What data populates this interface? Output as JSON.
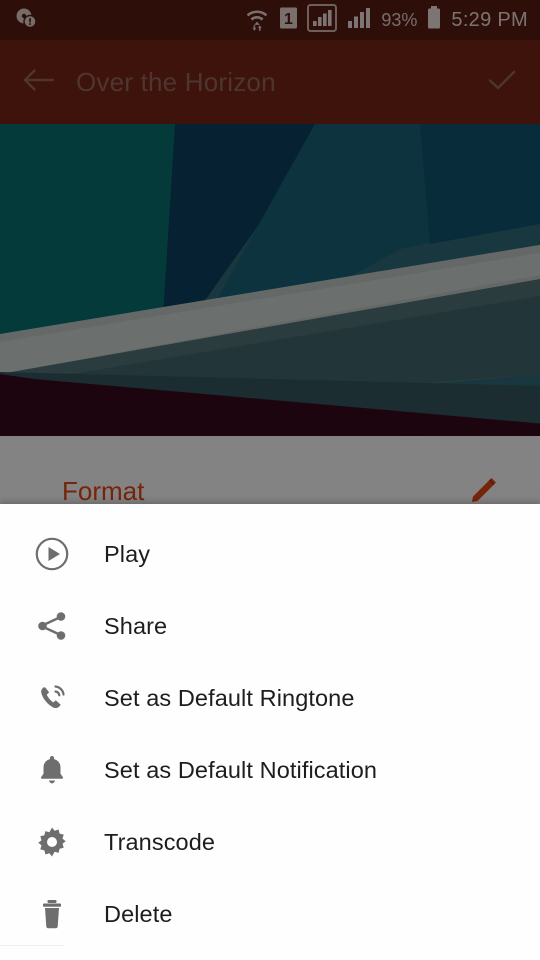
{
  "status_bar": {
    "notification_icon": "disc-alert-icon",
    "wifi_icon": "wifi-transfer-icon",
    "sim_icon": "sim-1-icon",
    "signal_icon_1": "signal-bars-boxed-icon",
    "signal_icon_2": "signal-bars-icon",
    "battery_percent": "93%",
    "battery_icon": "battery-icon",
    "clock": "5:29 PM",
    "background_color": "#551a0f"
  },
  "app_bar": {
    "back_icon": "arrow-back-icon",
    "title": "Over the Horizon",
    "confirm_icon": "check-icon",
    "background_color": "#722314",
    "title_color": "#8e6258"
  },
  "album_art": {
    "overflow_icon": "more-vertical-icon",
    "palette": {
      "teal": "#0a6a6a",
      "deep_blue": "#0b3f5c",
      "steel": "#2e6472",
      "light_gray": "#b9c2be",
      "slate": "#3c555c",
      "maroon": "#330a1c"
    }
  },
  "metadata": {
    "format_label": "Format",
    "format_color": "#d84315",
    "edit_icon": "edit-pencil-icon",
    "background_color": "#eeeeee"
  },
  "bottom_sheet": {
    "background_color": "#fefefe",
    "items": [
      {
        "label": "Play",
        "icon": "play-circle-icon"
      },
      {
        "label": "Share",
        "icon": "share-icon"
      },
      {
        "label": "Set as Default Ringtone",
        "icon": "ringtone-phone-icon"
      },
      {
        "label": "Set as Default Notification",
        "icon": "bell-icon"
      },
      {
        "label": "Transcode",
        "icon": "gear-icon"
      },
      {
        "label": "Delete",
        "icon": "trash-icon"
      }
    ]
  }
}
